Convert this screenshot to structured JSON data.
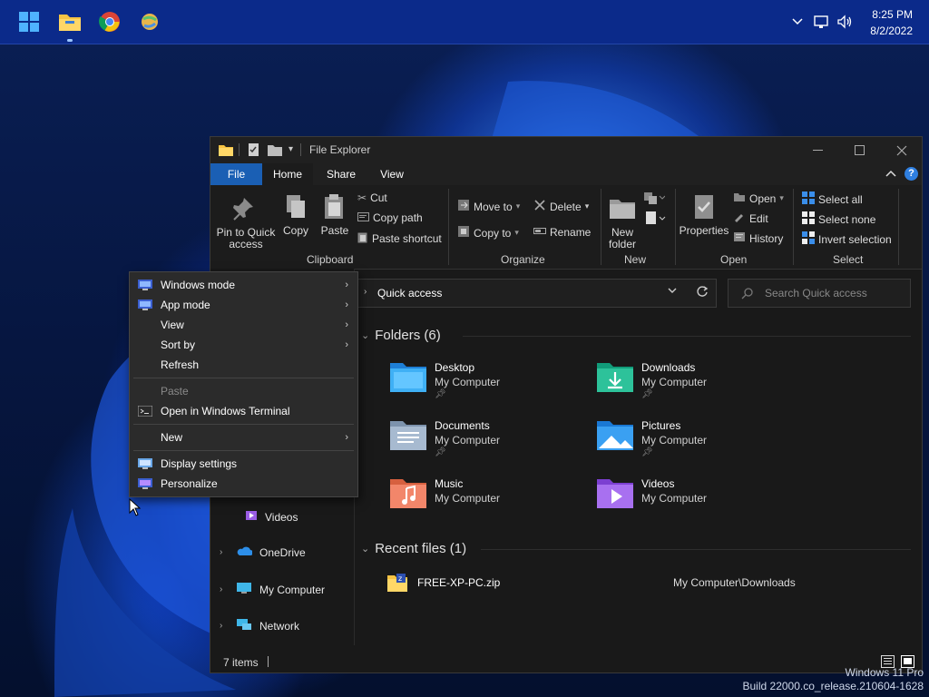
{
  "taskbar": {
    "icons": [
      "windows-start-icon",
      "file-explorer-icon",
      "chrome-icon",
      "ball-app-icon"
    ],
    "tray": [
      "chevron-up-icon",
      "network-icon",
      "volume-icon"
    ],
    "time": "8:25 PM",
    "date": "8/2/2022"
  },
  "watermark": {
    "line1": "Windows 11 Pro",
    "line2": "Build 22000.co_release.210604-1628"
  },
  "explorer": {
    "title": "File Explorer",
    "tabs": [
      "File",
      "Home",
      "Share",
      "View"
    ],
    "ribbon": {
      "clipboard": {
        "label": "Clipboard",
        "pin": "Pin to Quick access",
        "copy": "Copy",
        "paste": "Paste",
        "cut": "Cut",
        "copy_path": "Copy path",
        "paste_shortcut": "Paste shortcut"
      },
      "organize": {
        "label": "Organize",
        "move_to": "Move to",
        "copy_to": "Copy to",
        "delete": "Delete",
        "rename": "Rename"
      },
      "new": {
        "label": "New",
        "new_folder_1": "New",
        "new_folder_2": "folder"
      },
      "open": {
        "label": "Open",
        "properties": "Properties",
        "open": "Open",
        "edit": "Edit",
        "history": "History"
      },
      "select": {
        "label": "Select",
        "select_all": "Select all",
        "select_none": "Select none",
        "invert": "Invert selection"
      }
    },
    "address": "Quick access",
    "search_placeholder": "Search Quick access",
    "nav": {
      "videos": "Videos",
      "onedrive": "OneDrive",
      "mycomputer": "My Computer",
      "network": "Network"
    },
    "folders_header": "Folders (6)",
    "folders": [
      {
        "name": "Desktop",
        "location": "My Computer",
        "pinned": true
      },
      {
        "name": "Downloads",
        "location": "My Computer",
        "pinned": true
      },
      {
        "name": "Documents",
        "location": "My Computer",
        "pinned": true
      },
      {
        "name": "Pictures",
        "location": "My Computer",
        "pinned": true
      },
      {
        "name": "Music",
        "location": "My Computer",
        "pinned": false
      },
      {
        "name": "Videos",
        "location": "My Computer",
        "pinned": false
      }
    ],
    "recent_header": "Recent files (1)",
    "recent": [
      {
        "name": "FREE-XP-PC.zip",
        "path": "My Computer\\Downloads"
      }
    ],
    "status": "7 items"
  },
  "context_menu": {
    "items": [
      {
        "label": "Windows mode",
        "submenu": true
      },
      {
        "label": "App mode",
        "submenu": true
      },
      {
        "label": "View",
        "submenu": true
      },
      {
        "label": "Sort by",
        "submenu": true
      },
      {
        "label": "Refresh",
        "submenu": false
      },
      {
        "label": "Paste",
        "submenu": false,
        "disabled": true
      },
      {
        "label": "Open in Windows Terminal",
        "submenu": false
      },
      {
        "label": "New",
        "submenu": true
      },
      {
        "label": "Display settings",
        "submenu": false
      },
      {
        "label": "Personalize",
        "submenu": false
      }
    ]
  },
  "colors": {
    "taskbar": "#0b2a8a",
    "file_tab": "#1a5fb4",
    "window_bg": "#191919",
    "menu_bg": "#2b2b2b"
  }
}
